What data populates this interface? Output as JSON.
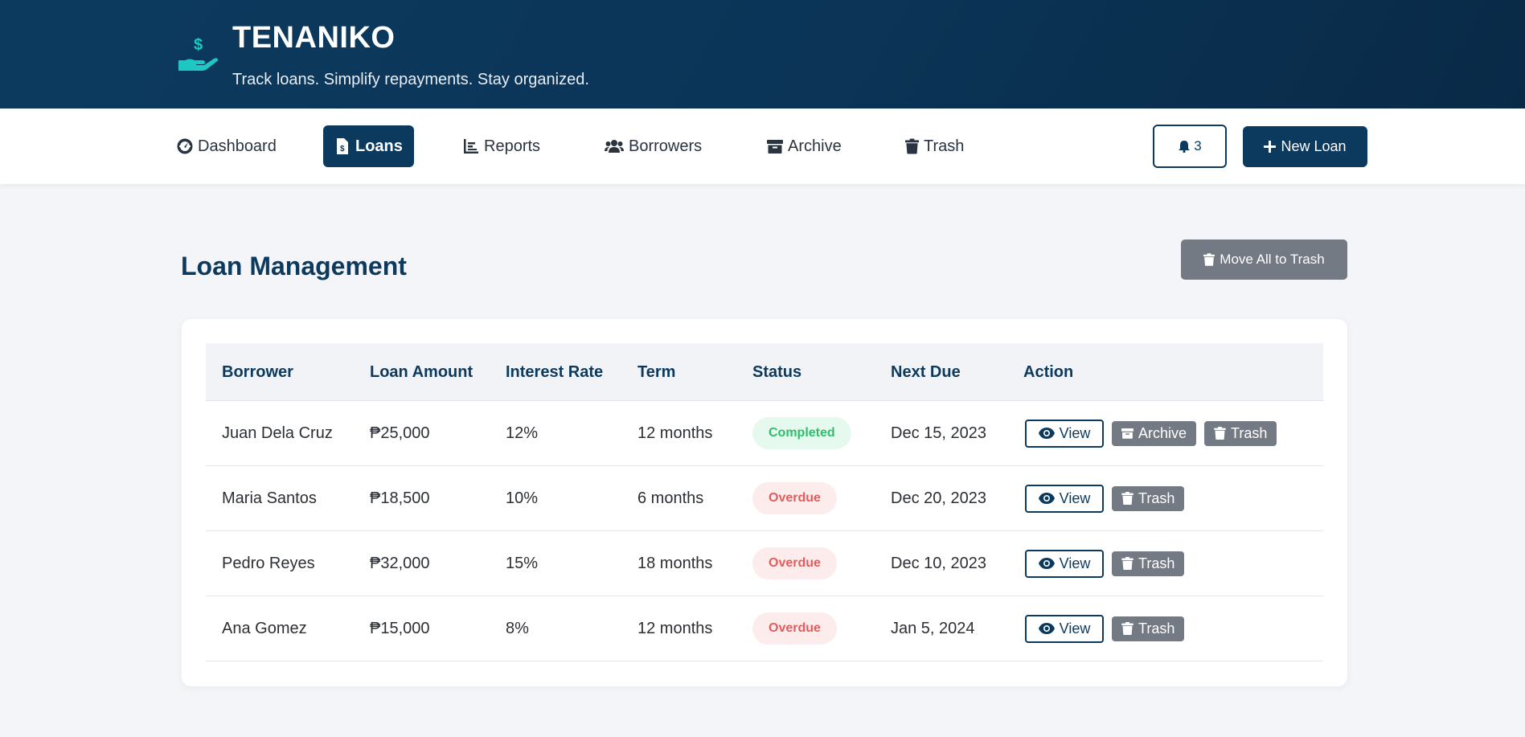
{
  "header": {
    "brand": "TENANIKO",
    "tagline": "Track loans. Simplify repayments. Stay organized."
  },
  "nav": {
    "items": [
      {
        "label": "Dashboard",
        "icon": "gauge-icon"
      },
      {
        "label": "Loans",
        "icon": "file-invoice-dollar-icon",
        "active": true
      },
      {
        "label": "Reports",
        "icon": "chart-icon"
      },
      {
        "label": "Borrowers",
        "icon": "users-icon"
      },
      {
        "label": "Archive",
        "icon": "archive-icon"
      },
      {
        "label": "Trash",
        "icon": "trash-icon"
      }
    ],
    "notifications_count": "3",
    "new_loan_label": "New Loan"
  },
  "main": {
    "title": "Loan Management",
    "move_all_label": "Move All to Trash"
  },
  "table": {
    "columns": [
      "Borrower",
      "Loan Amount",
      "Interest Rate",
      "Term",
      "Status",
      "Next Due",
      "Action"
    ],
    "rows": [
      {
        "borrower": "Juan Dela Cruz",
        "amount": "₱25,000",
        "rate": "12%",
        "term": "12 months",
        "status": "Completed",
        "next_due": "Dec 15, 2023",
        "actions": [
          "View",
          "Archive",
          "Trash"
        ]
      },
      {
        "borrower": "Maria Santos",
        "amount": "₱18,500",
        "rate": "10%",
        "term": "6 months",
        "status": "Overdue",
        "next_due": "Dec 20, 2023",
        "actions": [
          "View",
          "Trash"
        ]
      },
      {
        "borrower": "Pedro Reyes",
        "amount": "₱32,000",
        "rate": "15%",
        "term": "18 months",
        "status": "Overdue",
        "next_due": "Dec 10, 2023",
        "actions": [
          "View",
          "Trash"
        ]
      },
      {
        "borrower": "Ana Gomez",
        "amount": "₱15,000",
        "rate": "8%",
        "term": "12 months",
        "status": "Overdue",
        "next_due": "Jan 5, 2024",
        "actions": [
          "View",
          "Trash"
        ]
      }
    ]
  },
  "colors": {
    "primary": "#0c3a5f",
    "accent": "#1fc7c2",
    "gray_button": "#737a83",
    "completed": "#2fbe6c",
    "overdue": "#e35d5d"
  }
}
